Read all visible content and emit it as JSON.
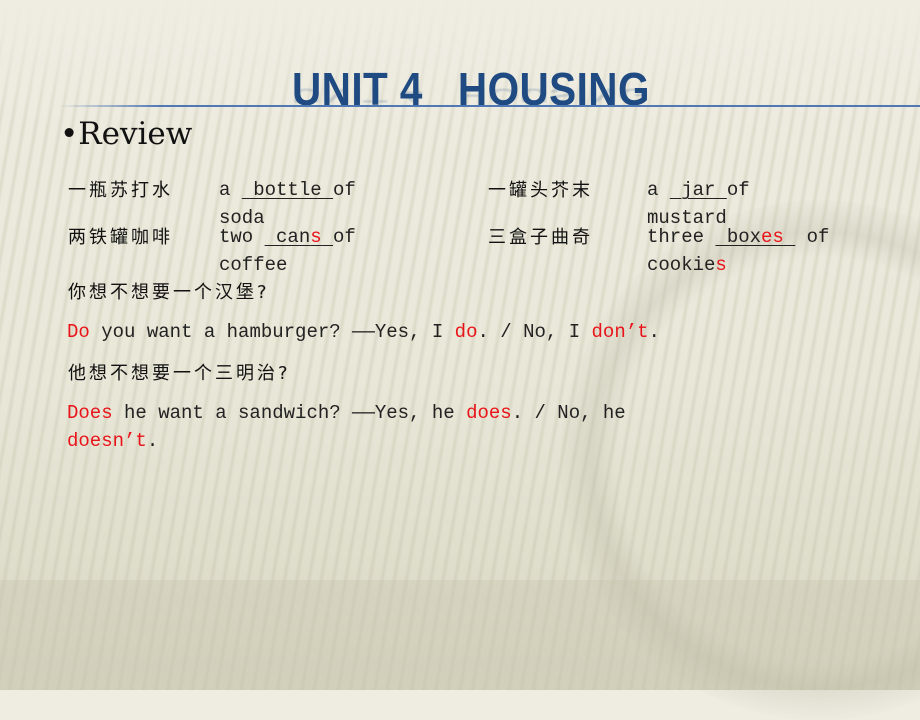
{
  "slide": {
    "title": "UNIT 4   HOUSING",
    "bullet": "•",
    "section": "Review"
  },
  "vocab": [
    {
      "chinese": "一瓶苏打水",
      "prefix": "a ",
      "blank_pre": " bottle ",
      "blank_red": "",
      "blank_post": "",
      "suffix": "of",
      "line2": "soda",
      "line2_red": ""
    },
    {
      "chinese": "两铁罐咖啡",
      "prefix": "two ",
      "blank_pre": " can",
      "blank_red": "s",
      "blank_post": " ",
      "suffix": "of",
      "line2": "coffee",
      "line2_red": ""
    },
    {
      "chinese": "一罐头芥末",
      "prefix": "a ",
      "blank_pre": " jar ",
      "blank_red": "",
      "blank_post": "",
      "suffix": "of",
      "line2": "mustard",
      "line2_red": ""
    },
    {
      "chinese": "三盒子曲奇",
      "prefix": "three ",
      "blank_pre": " box",
      "blank_red": "es",
      "blank_post": " ",
      "suffix": " of",
      "line2": "cookie",
      "line2_red": "s"
    }
  ],
  "questions": [
    {
      "chinese": "你想不想要一个汉堡?",
      "parts": [
        {
          "text": "Do",
          "red": true
        },
        {
          "text": " you want a hamburger? ——Yes, I ",
          "red": false
        },
        {
          "text": "do",
          "red": true
        },
        {
          "text": ". / No, I ",
          "red": false
        },
        {
          "text": "don’t",
          "red": true
        },
        {
          "text": ".",
          "red": false
        }
      ]
    },
    {
      "chinese": "他想不想要一个三明治?",
      "parts_line1": [
        {
          "text": "Does",
          "red": true
        },
        {
          "text": " he want a sandwich? ——Yes, he ",
          "red": false
        },
        {
          "text": "does",
          "red": true
        },
        {
          "text": ". / No, he",
          "red": false
        }
      ],
      "parts_line2": [
        {
          "text": "doesn’t",
          "red": true
        },
        {
          "text": ".",
          "red": false
        }
      ]
    }
  ],
  "colors": {
    "title": "#1f4a82",
    "rule": "#4f78b4",
    "answer_red": "#e8141a",
    "text": "#222222"
  }
}
